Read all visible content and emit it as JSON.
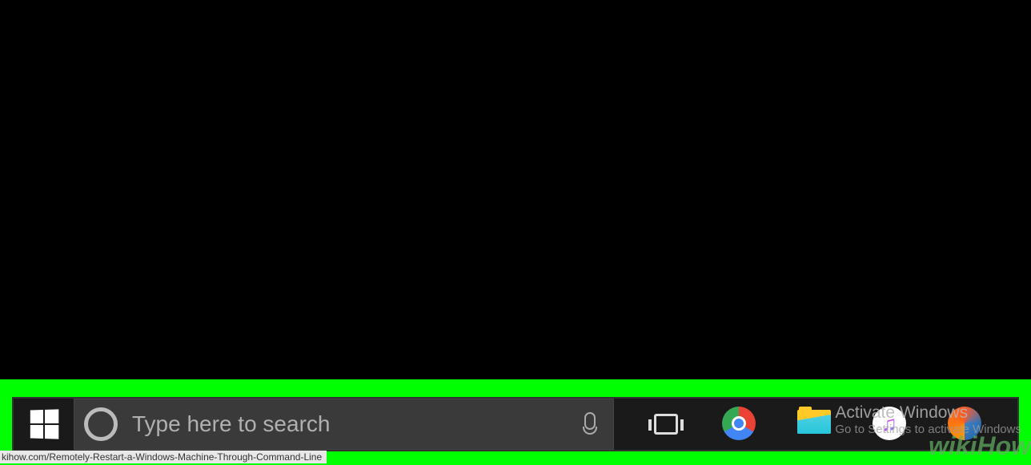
{
  "desktop": {},
  "taskbar": {
    "search": {
      "placeholder": "Type here to search"
    },
    "apps": [
      {
        "name": "chrome",
        "label": "Google Chrome"
      },
      {
        "name": "explorer",
        "label": "File Explorer"
      },
      {
        "name": "itunes",
        "label": "iTunes"
      },
      {
        "name": "firefox",
        "label": "Firefox"
      }
    ]
  },
  "watermark": {
    "activate_title": "Activate Windows",
    "activate_subtitle": "Go to Settings to activate Windows"
  },
  "url_label": "kihow.com/Remotely-Restart-a-Windows-Machine-Through-Command-Line",
  "wikihow_text": "wikiHow"
}
